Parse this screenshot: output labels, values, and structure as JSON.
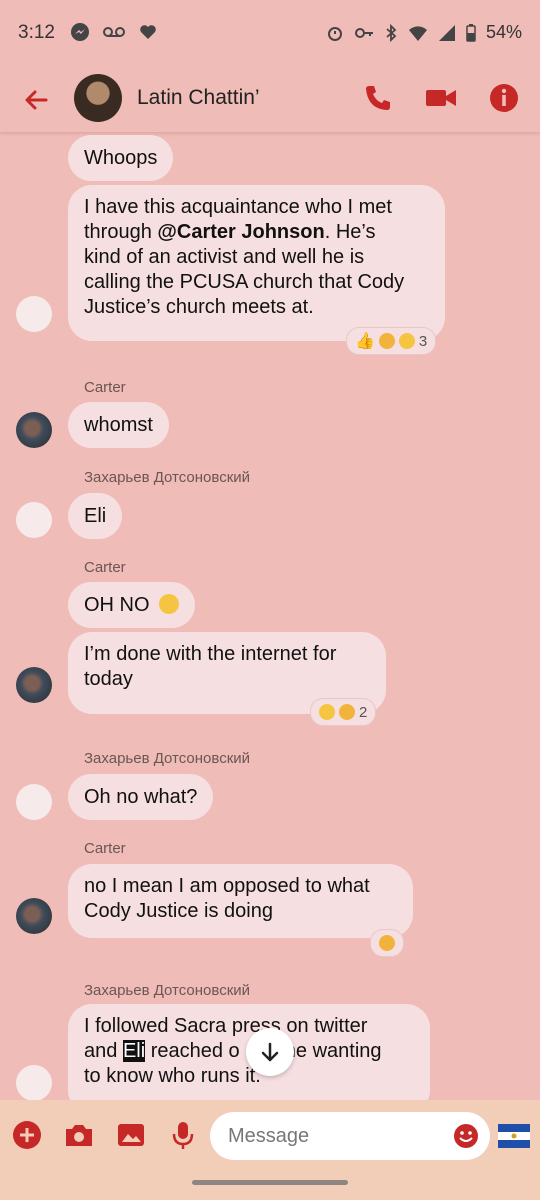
{
  "status_bar": {
    "time": "3:12",
    "battery": "54%"
  },
  "header": {
    "title": "Latin Chattin’"
  },
  "messages": {
    "m1": "Whoops",
    "m2_line1": "I have this acquaintance who I met",
    "m2_line2a": "through ",
    "m2_mention": "@Carter Johnson",
    "m2_line2b": ". He’s",
    "m2_line3": "kind of an activist and well he is",
    "m2_line4": "calling the PCUSA church that Cody",
    "m2_line5": "Justice’s church meets at.",
    "m2_react_count": "3",
    "s1": "Carter",
    "m3": "whomst",
    "s2": "Захарьев Дотсоновский",
    "m4": "Eli",
    "s3": "Carter",
    "m5": "OH NO",
    "m6_line1": "I’m done with the internet for",
    "m6_line2": "today",
    "m6_react_count": "2",
    "s4": "Захарьев Дотсоновский",
    "m7": "Oh no what?",
    "s5": "Carter",
    "m8_line1": "no I mean I am opposed to what",
    "m8_line2": "Cody Justice is doing",
    "s6": "Захарьев Дотсоновский",
    "m9_line1": "I followed Sacra press on twitter",
    "m9_line2a": "and ",
    "m9_highlight": "Eli",
    "m9_line2b": " reached o",
    "m9_line2c": " me wanting",
    "m9_line3": "to know who runs it."
  },
  "composer": {
    "placeholder": "Message"
  },
  "colors": {
    "accent": "#c62828",
    "background": "#f0bcb7",
    "bubble": "#f6dfe1",
    "composer": "#f2cdb8"
  }
}
